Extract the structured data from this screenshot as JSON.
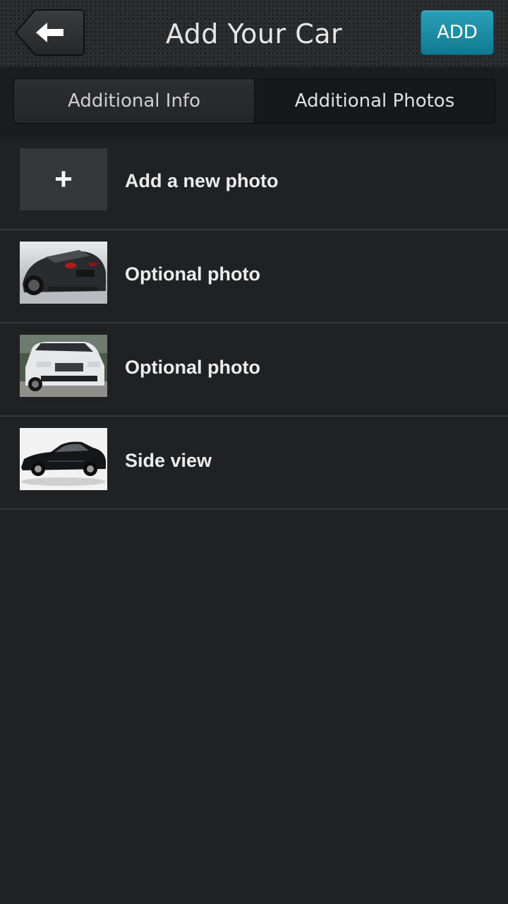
{
  "header": {
    "title": "Add Your Car",
    "back_icon": "arrow-left-icon",
    "add_label": "ADD",
    "accent_color": "#1a8ea6"
  },
  "tabs": [
    {
      "label": "Additional Info",
      "selected": false
    },
    {
      "label": "Additional Photos",
      "selected": true
    }
  ],
  "photos": {
    "add_icon": "plus-icon",
    "add_label": "Add a new photo",
    "items": [
      {
        "label": "Optional photo",
        "thumbnail": "dark-sports-car-front"
      },
      {
        "label": "Optional photo",
        "thumbnail": "white-suv-front"
      },
      {
        "label": "Side view",
        "thumbnail": "black-sedan-side"
      }
    ]
  }
}
